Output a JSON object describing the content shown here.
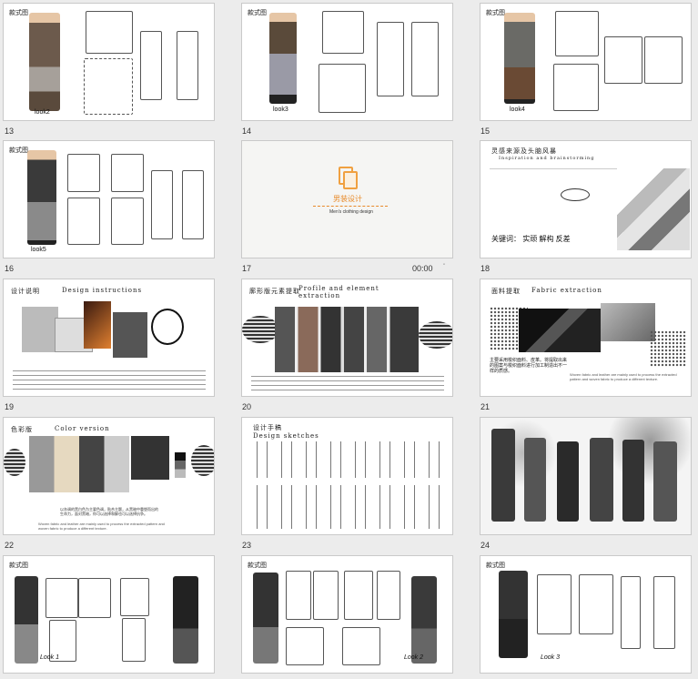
{
  "slides": [
    {
      "num": "13",
      "label": "款式图",
      "caption": "look2"
    },
    {
      "num": "14",
      "label": "款式图",
      "caption": "look3"
    },
    {
      "num": "15",
      "label": "款式图",
      "caption": "look4"
    },
    {
      "num": "16",
      "label": "款式图",
      "caption": "look5"
    },
    {
      "num": "17",
      "title": "男装设计",
      "subtitle": "Men's clothing design",
      "time": "00:00"
    },
    {
      "num": "18",
      "heading": "灵感来源及头脑风暴",
      "heading_en": "Inspiration and brainstorming",
      "keywords": "关键词： 实顽 解构 反差"
    },
    {
      "num": "19",
      "heading": "设计说明",
      "heading_en": "Design instructions"
    },
    {
      "num": "20",
      "heading": "廓形版元素提取",
      "heading_en": "Profile and element extraction"
    },
    {
      "num": "21",
      "heading": "面料提取",
      "heading_en": "Fabric extraction",
      "body": "主要采用梭织面料、皮革。将提取出来的图案与梭织面料进行加工制造出不一样的质感。",
      "body_en": "Woven fabric and leather are mainly used to process the extracted pattern and woven fabric to produce a different texture."
    },
    {
      "num": "22",
      "heading": "色彩版",
      "heading_en": "Color version",
      "body": "以灰调的黑白色为主要色调，贴合主题，从黑暗中重塑而出的生命力，面对黑暗，你可以选择和解也可以选择抗争。",
      "body_en": "Woven fabric and leather are mainly used to process the extracted pattern and woven fabric to produce a different texture."
    },
    {
      "num": "23",
      "heading": "设计手稿",
      "heading_en": "Design sketches"
    },
    {
      "num": "24"
    },
    {
      "num": "",
      "label": "款式图",
      "caption": "Look 1"
    },
    {
      "num": "",
      "label": "款式图",
      "caption": "Look 2"
    },
    {
      "num": "",
      "label": "款式图",
      "caption": "Look 3"
    }
  ]
}
